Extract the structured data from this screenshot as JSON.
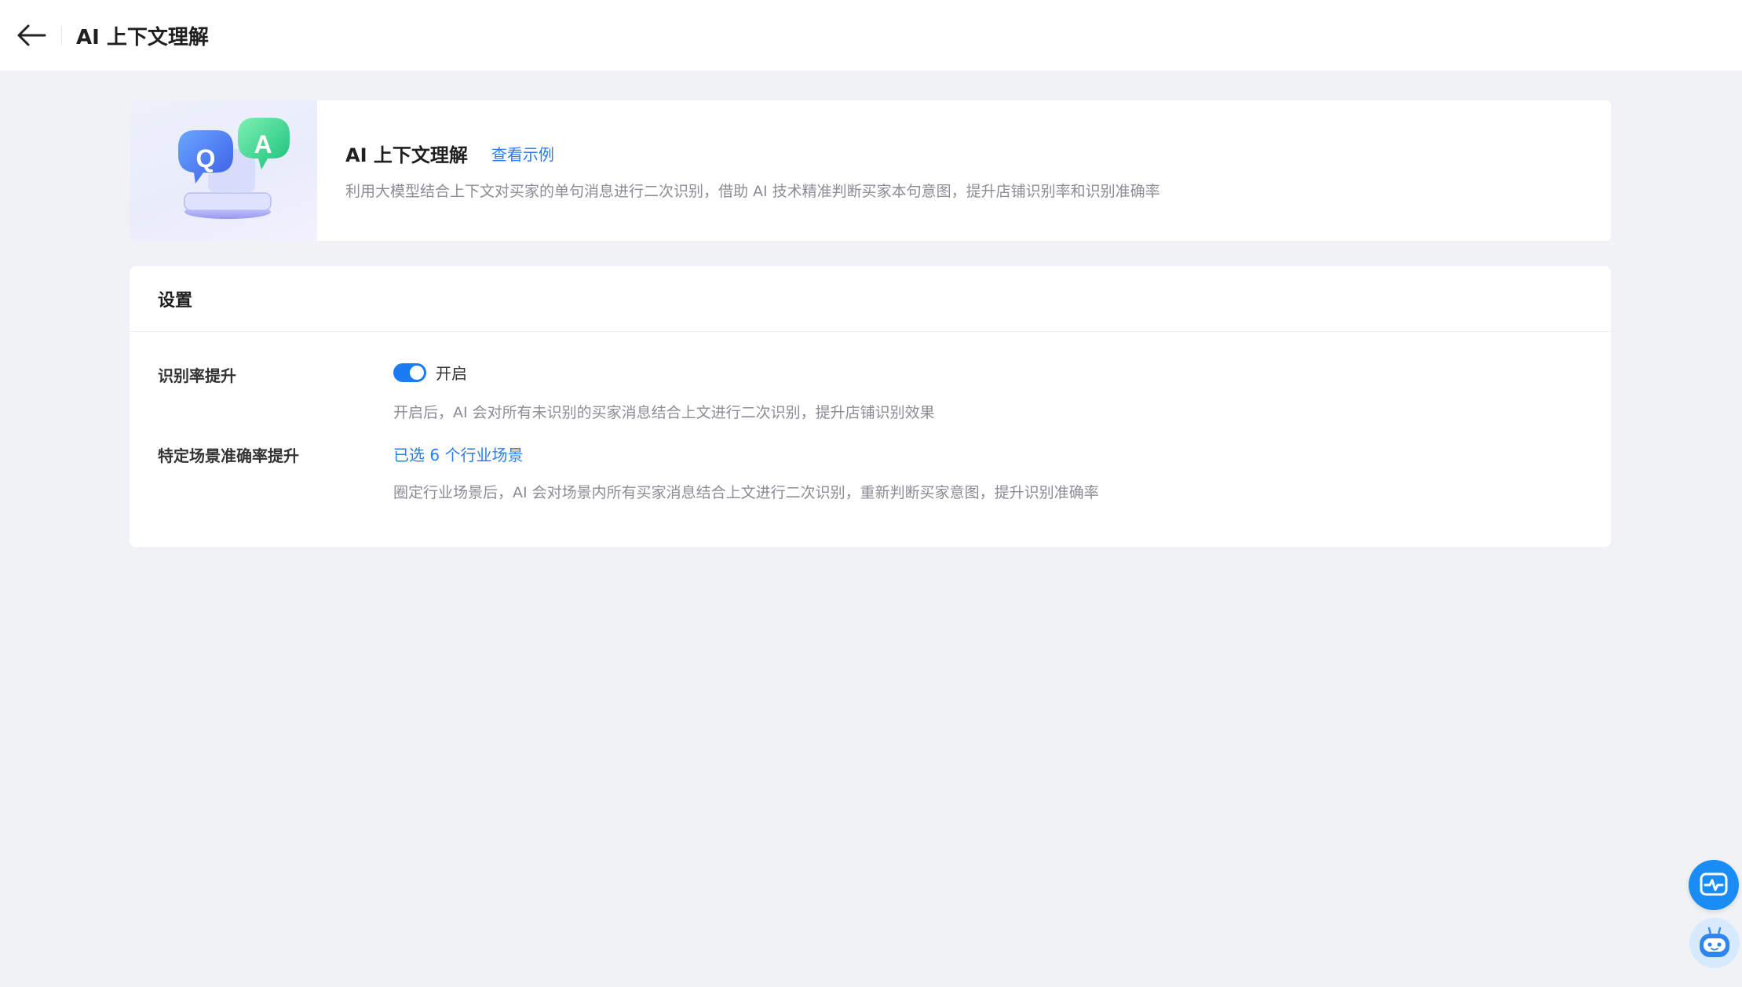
{
  "header": {
    "back_icon": "arrow-left-icon",
    "title": "AI 上下文理解"
  },
  "intro": {
    "image_icon": "qa-chat-bubbles-illustration",
    "image_letters": [
      "Q",
      "A"
    ],
    "title": "AI 上下文理解",
    "link_label": "查看示例",
    "description": "利用大模型结合上下文对买家的单句消息进行二次识别，借助 AI 技术精准判断买家本句意图，提升店铺识别率和识别准确率"
  },
  "settings": {
    "title": "设置",
    "recognition": {
      "label": "识别率提升",
      "toggle_on": true,
      "toggle_text": "开启",
      "description": "开启后，AI 会对所有未识别的买家消息结合上文进行二次识别，提升店铺识别效果"
    },
    "scenario": {
      "label": "特定场景准确率提升",
      "link_label": "已选 6 个行业场景",
      "description": "圈定行业场景后，AI 会对场景内所有买家消息结合上文进行二次识别，重新判断买家意图，提升识别准确率"
    }
  },
  "floating": {
    "monitor_icon": "heartbeat-monitor-icon",
    "assistant_icon": "robot-assistant-icon"
  },
  "colors": {
    "accent": "#1a7bf2",
    "link": "#2a7df0",
    "background": "#f0f2f5"
  }
}
